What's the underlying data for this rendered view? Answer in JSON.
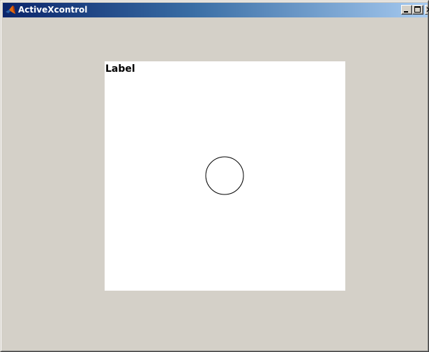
{
  "window": {
    "title": "ActiveXcontrol",
    "icon": "matlab-logo-icon",
    "caption_buttons": {
      "minimize": "minimize-icon",
      "maximize": "maximize-icon",
      "close": "close-icon",
      "close_glyph": "✕"
    }
  },
  "control": {
    "label": "Label",
    "shape": "circle"
  },
  "colors": {
    "titlebar_start": "#0a246a",
    "titlebar_end": "#a6caf0",
    "window_face": "#d4d0c8",
    "control_background": "#ffffff"
  }
}
